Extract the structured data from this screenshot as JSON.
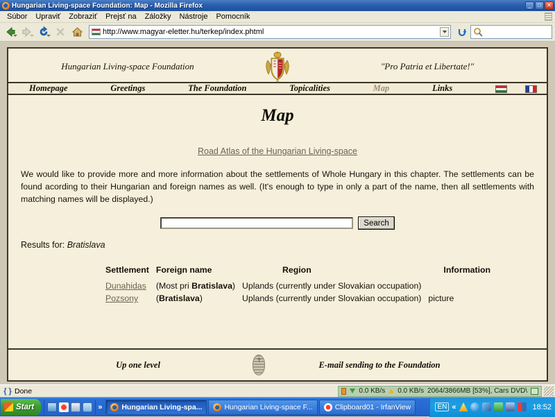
{
  "browser": {
    "window_title": "Hungarian Living-space Foundation: Map - Mozilla Firefox",
    "window_buttons": {
      "minimize": "_",
      "maximize": "□",
      "close": "✕"
    },
    "menu": [
      {
        "label": "Súbor"
      },
      {
        "label": "Upraviť"
      },
      {
        "label": "Zobraziť"
      },
      {
        "label": "Prejsť na"
      },
      {
        "label": "Záložky"
      },
      {
        "label": "Nástroje"
      },
      {
        "label": "Pomocník"
      }
    ],
    "toolbar": {
      "back_icon": "back-arrow-icon",
      "forward_icon": "forward-arrow-icon",
      "reload_icon": "reload-icon",
      "stop_icon": "stop-icon",
      "home_icon": "home-icon",
      "go_icon": "go-icon",
      "search_icon": "magnifier-icon"
    },
    "url": "http://www.magyar-eletter.hu/terkep/index.phtml",
    "url_placeholder": "",
    "toolbar_search_value": "",
    "toolbar_search_placeholder": ""
  },
  "site": {
    "title": "Hungarian Living-space Foundation",
    "motto": "\"Pro Patria et Libertate!\"",
    "crest_icon": "hungarian-coat-of-arms-icon",
    "nav": [
      {
        "label": "Homepage",
        "current": false
      },
      {
        "label": "Greetings",
        "current": false
      },
      {
        "label": "The Foundation",
        "current": false
      },
      {
        "label": "Topicalities",
        "current": false
      },
      {
        "label": "Map",
        "current": true
      },
      {
        "label": "Links",
        "current": false
      }
    ],
    "nav_flags": [
      {
        "name": "hungarian-flag-icon"
      },
      {
        "name": "french-flag-icon"
      }
    ]
  },
  "main": {
    "page_title": "Map",
    "atlas_link": "Road Atlas of the Hungarian Living-space",
    "intro": "We would like to provide more and more information about the settlements of Whole Hungary in this chapter. The settlements can be found acording to their Hungarian and foreign names as well. (It's enough to type in only a part of the name, then all settlements with matching names will be displayed.)",
    "search_value": "",
    "search_placeholder": "",
    "search_button": "Search",
    "results_label": "Results for:",
    "results_term": "Bratislava",
    "table": {
      "headers": [
        "Settlement",
        "Foreign name",
        "Region",
        "Information"
      ],
      "rows": [
        {
          "settlement": "Dunahidas",
          "foreign_prefix": "(Most pri ",
          "foreign_bold": "Bratislava",
          "foreign_suffix": ")",
          "region": "Uplands (currently under Slovakian occupation)",
          "information": ""
        },
        {
          "settlement": "Pozsony",
          "foreign_prefix": "(",
          "foreign_bold": "Bratislava",
          "foreign_suffix": ")",
          "region": "Uplands (currently under Slovakian occupation)",
          "information": "picture"
        }
      ]
    }
  },
  "footer": {
    "up_link": "Up one level",
    "emblem_icon": "hungarian-shield-emblem-icon",
    "email_link": "E-mail sending to the Foundation"
  },
  "statusbar": {
    "spinner_icon": "throbber-icon",
    "status_text": "Done",
    "download_speed": "0.0 KB/s",
    "upload_speed": "0.0 KB/s",
    "memory": "2064/3866MB [53%], Cars DVD\\",
    "resize_grip_icon": "resize-grip-icon"
  },
  "taskbar": {
    "start_label": "Start",
    "start_icon": "windows-flag-icon",
    "quicklaunch": [
      {
        "name": "show-desktop-icon"
      },
      {
        "name": "irfanview-icon"
      },
      {
        "name": "calculator-icon"
      },
      {
        "name": "explorer-icon"
      }
    ],
    "chevron": "»",
    "tasks": [
      {
        "label": "Hungarian Living-spa...",
        "icon": "firefox-icon",
        "active": true
      },
      {
        "label": "Hungarian Living-space F...",
        "icon": "firefox-icon",
        "active": false
      },
      {
        "label": "Clipboard01 - IrfanView",
        "icon": "irfanview-icon",
        "active": false
      }
    ],
    "tray": [
      {
        "name": "language-bar-icon",
        "label": "EN"
      },
      {
        "name": "tray-chevron-icon",
        "label": "«"
      },
      {
        "name": "warning-icon"
      },
      {
        "name": "network-globe-icon"
      },
      {
        "name": "media-icon"
      },
      {
        "name": "network-connection-icon"
      },
      {
        "name": "printer-icon"
      },
      {
        "name": "volume-icon"
      }
    ],
    "clock": "18:52"
  }
}
